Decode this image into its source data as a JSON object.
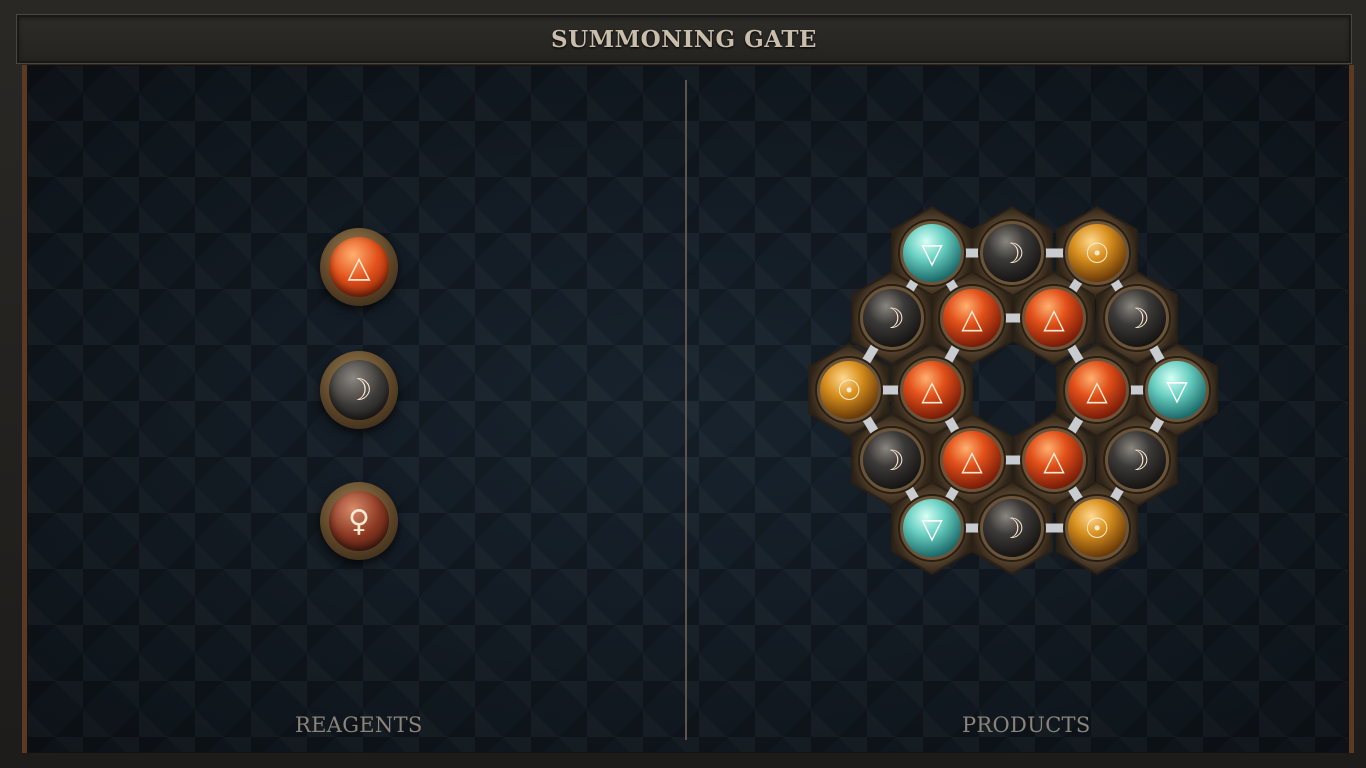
{
  "header": {
    "title": "SUMMONING GATE"
  },
  "panels": {
    "reagents_label": "REAGENTS",
    "products_label": "PRODUCTS"
  },
  "reagents": [
    {
      "name": "fire",
      "symbol": "△"
    },
    {
      "name": "salt",
      "symbol": "☽"
    },
    {
      "name": "copper",
      "symbol": "♀"
    }
  ],
  "product": {
    "atoms": [
      {
        "element": "water",
        "symbol": "▽"
      },
      {
        "element": "salt",
        "symbol": "☽"
      },
      {
        "element": "gold",
        "symbol": "☉"
      },
      {
        "element": "salt",
        "symbol": "☽"
      },
      {
        "element": "fire",
        "symbol": "△"
      },
      {
        "element": "fire",
        "symbol": "△"
      },
      {
        "element": "salt",
        "symbol": "☽"
      },
      {
        "element": "gold",
        "symbol": "☉"
      },
      {
        "element": "fire",
        "symbol": "△"
      },
      {
        "element": "fire",
        "symbol": "△"
      },
      {
        "element": "water",
        "symbol": "▽"
      },
      {
        "element": "salt",
        "symbol": "☽"
      },
      {
        "element": "fire",
        "symbol": "△"
      },
      {
        "element": "fire",
        "symbol": "△"
      },
      {
        "element": "salt",
        "symbol": "☽"
      },
      {
        "element": "water",
        "symbol": "▽"
      },
      {
        "element": "salt",
        "symbol": "☽"
      },
      {
        "element": "gold",
        "symbol": "☉"
      }
    ]
  },
  "colors": {
    "fire": "#e2501a",
    "salt": "#3c3a38",
    "copper": "#8a3822",
    "water": "#6ad0c2",
    "gold": "#d8901e",
    "frame_accent": "#5a3a22"
  }
}
